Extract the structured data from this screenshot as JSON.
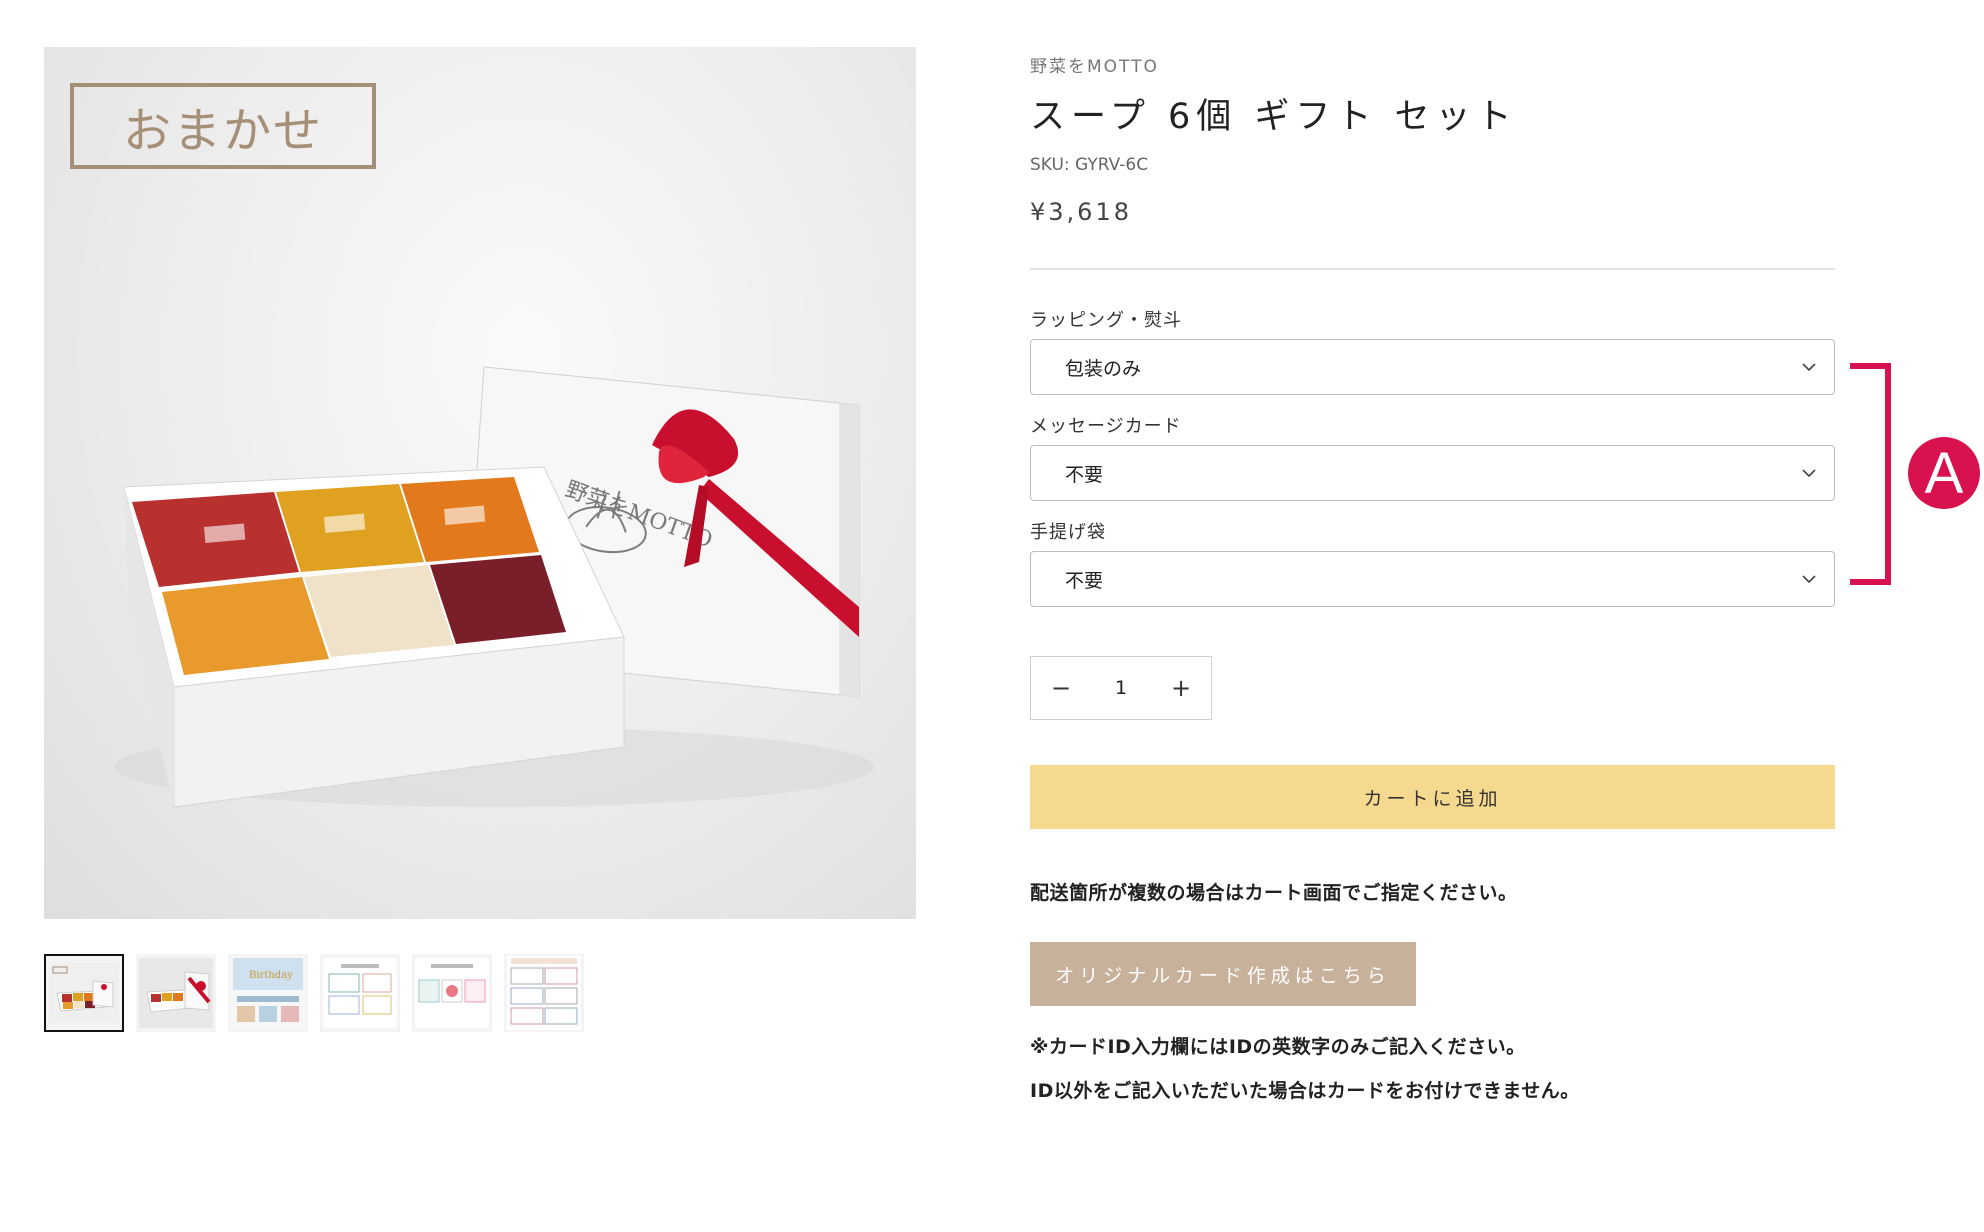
{
  "gallery": {
    "badge_text": "おまかせ",
    "thumbnails": [
      {
        "icon": "gift-box-photo",
        "active": true
      },
      {
        "icon": "gift-box-ribbon-photo",
        "active": false
      },
      {
        "icon": "birthday-card-image",
        "active": false
      },
      {
        "icon": "message-card-sheet-image",
        "active": false
      },
      {
        "icon": "message-card-samples-image",
        "active": false
      },
      {
        "icon": "card-templates-image",
        "active": false
      }
    ]
  },
  "product": {
    "vendor": "野菜をMOTTO",
    "title": "スープ 6個 ギフト セット",
    "sku": "SKU: GYRV-6C",
    "price": "¥3,618"
  },
  "options": [
    {
      "label": "ラッピング・熨斗",
      "selected": "包装のみ"
    },
    {
      "label": "メッセージカード",
      "selected": "不要"
    },
    {
      "label": "手提げ袋",
      "selected": "不要"
    }
  ],
  "annotation": {
    "badge": "A",
    "color": "#d7124f"
  },
  "quantity": {
    "value": "1",
    "minus": "−",
    "plus": "+"
  },
  "add_to_cart": {
    "label": "カートに追加",
    "color": "#f5d98f"
  },
  "notes": {
    "multi_shipping": "配送箇所が複数の場合はカート画面でご指定ください。",
    "card_id_1": "※カードID入力欄にはIDの英数字のみご記入ください。",
    "card_id_2": "ID以外をご記入いただいた場合はカードをお付けできません。"
  },
  "original_card_button": {
    "label": "オリジナルカード作成はこちら",
    "color": "#c7b19b"
  }
}
